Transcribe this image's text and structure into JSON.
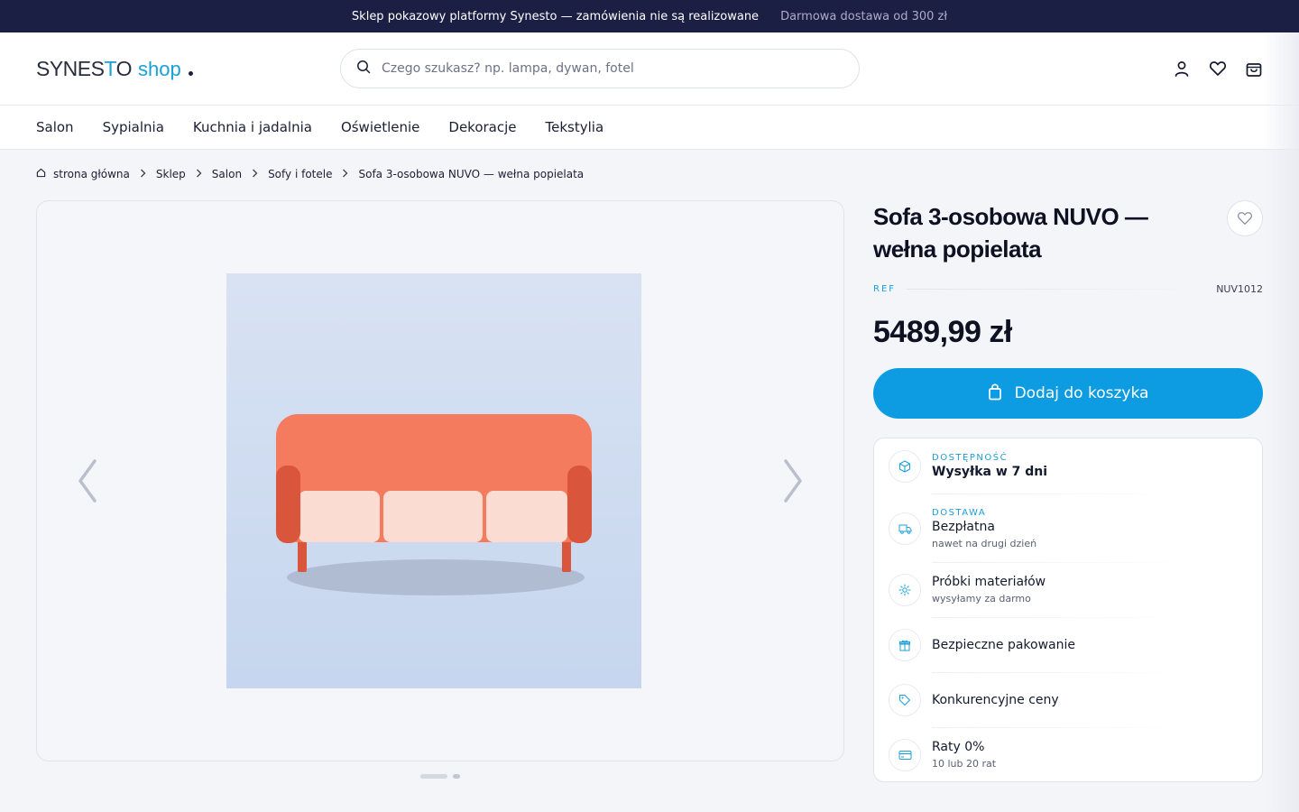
{
  "topbar": {
    "notice": "Sklep pokazowy platformy Synesto — zamówienia nie są realizowane",
    "shipping": "Darmowa dostawa od 300 zł"
  },
  "header": {
    "logo_brand": "SYNESTO",
    "logo_shop": "shop",
    "search_placeholder": "Czego szukasz? np. lampa, dywan, fotel",
    "icons": [
      "user-icon",
      "heart-icon",
      "bag-icon"
    ]
  },
  "nav": {
    "items": [
      {
        "label": "Salon"
      },
      {
        "label": "Sypialnia"
      },
      {
        "label": "Kuchnia i jadalnia"
      },
      {
        "label": "Oświetlenie"
      },
      {
        "label": "Dekoracje"
      },
      {
        "label": "Tekstylia"
      }
    ]
  },
  "breadcrumb": {
    "items": [
      {
        "label": "strona główna"
      },
      {
        "label": "Sklep"
      },
      {
        "label": "Salon"
      },
      {
        "label": "Sofy i fotele"
      },
      {
        "label": "Sofa 3-osobowa NUVO — wełna popielata"
      }
    ]
  },
  "gallery": {
    "slides_total": 2,
    "active_slide": 1
  },
  "product": {
    "title": "Sofa 3-osobowa NUVO — wełna popielata",
    "ref_label": "REF",
    "ref_value": "NUV1012",
    "price": "5489,99 zł",
    "add_to_cart": "Dodaj do koszyka"
  },
  "features": [
    {
      "icon": "box-icon",
      "caption": "DOSTĘPNOŚĆ",
      "main": "Wysyłka w 7 dni",
      "sub": ""
    },
    {
      "icon": "truck-icon",
      "caption": "DOSTAWA",
      "main": "Bezpłatna",
      "sub": "nawet na drugi dzień"
    },
    {
      "icon": "sparkle-icon",
      "caption": "",
      "main": "Próbki materiałów",
      "sub": "wysyłamy za darmo"
    },
    {
      "icon": "gift-icon",
      "caption": "",
      "main": "Bezpieczne pakowanie",
      "sub": ""
    },
    {
      "icon": "tag-icon",
      "caption": "",
      "main": "Konkurencyjne ceny",
      "sub": ""
    },
    {
      "icon": "card-icon",
      "caption": "",
      "main": "Raty 0%",
      "sub": "10 lub 20 rat"
    }
  ],
  "colors": {
    "topbar_bg": "#1c1f44",
    "accent": "#0d9be1",
    "sofa_back": "#f47b5e",
    "sofa_cushion": "#fadcd2",
    "sofa_arm": "#d9553c"
  }
}
